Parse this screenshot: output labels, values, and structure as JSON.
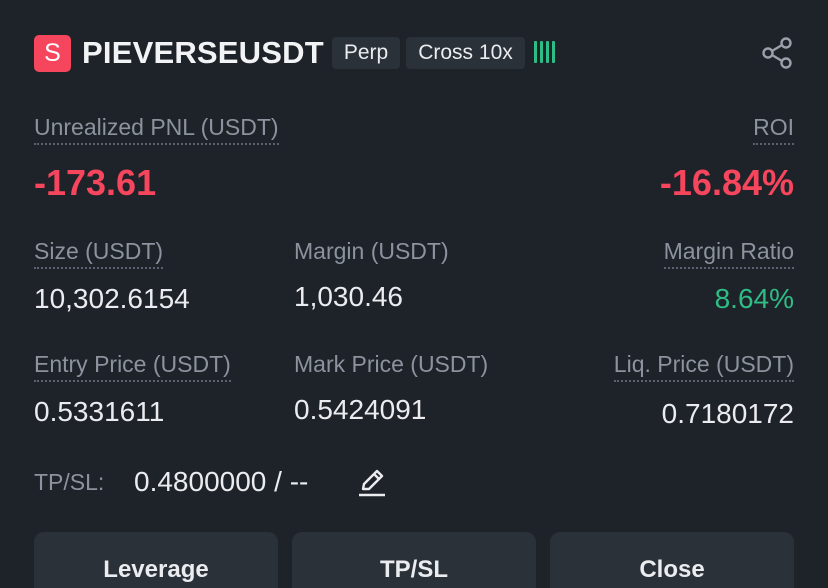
{
  "header": {
    "side_badge": "S",
    "symbol": "PIEVERSEUSDT",
    "tags": [
      "Perp",
      "Cross 10x"
    ],
    "signal_icon": "signal-bars-icon",
    "share_icon": "share-icon",
    "signal_color": "#2ebd85"
  },
  "pnl": {
    "label": "Unrealized PNL (USDT)",
    "value": "-173.61",
    "roi_label": "ROI",
    "roi_value": "-16.84%"
  },
  "stats": {
    "size_label": "Size (USDT)",
    "size_value": "10,302.6154",
    "margin_label": "Margin (USDT)",
    "margin_value": "1,030.46",
    "margin_ratio_label": "Margin Ratio",
    "margin_ratio_value": "8.64%",
    "entry_label": "Entry Price (USDT)",
    "entry_value": "0.5331611",
    "mark_label": "Mark Price (USDT)",
    "mark_value": "0.5424091",
    "liq_label": "Liq. Price (USDT)",
    "liq_value": "0.7180172"
  },
  "tpsl": {
    "label": "TP/SL:",
    "value": "0.4800000 / --",
    "edit_icon": "edit-pencil-icon"
  },
  "actions": {
    "leverage": "Leverage",
    "tpsl": "TP/SL",
    "close": "Close"
  },
  "colors": {
    "background": "#1e2229",
    "negative": "#f6465d",
    "positive": "#2ebd85",
    "button_bg": "#2b3139"
  }
}
